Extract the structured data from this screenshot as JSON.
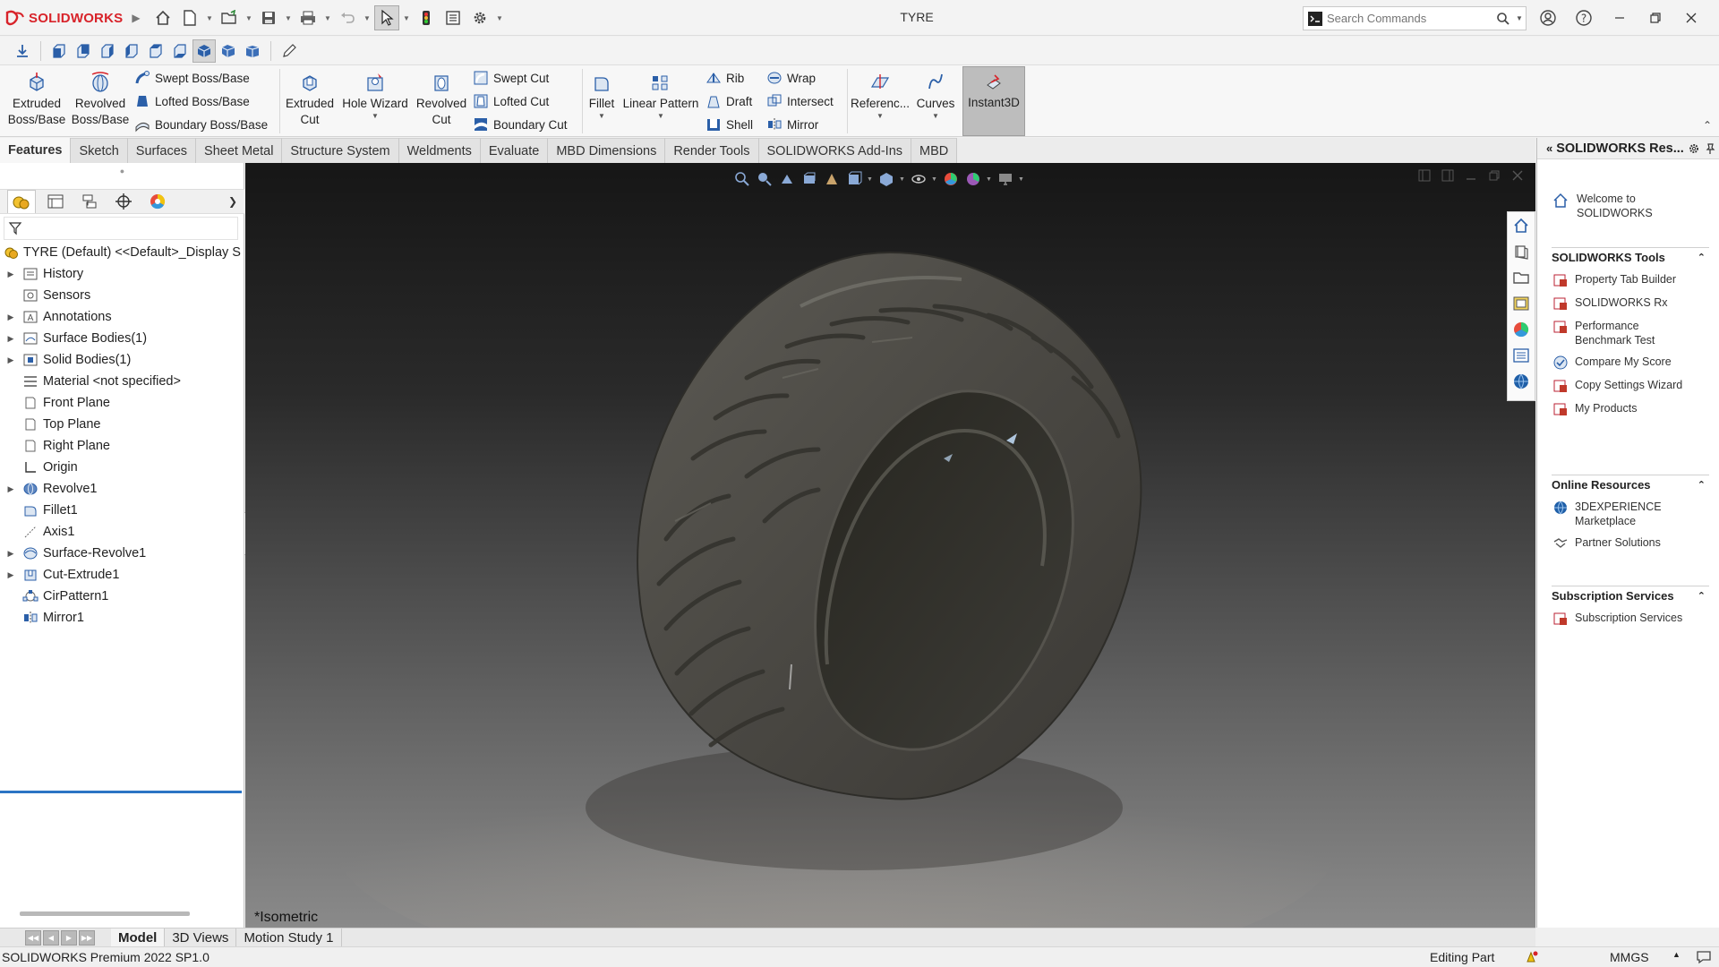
{
  "app": {
    "brand": "SOLIDWORKS",
    "doc_title": "TYRE",
    "search_placeholder": "Search Commands"
  },
  "ribbon": {
    "extruded_boss": [
      "Extruded",
      "Boss/Base"
    ],
    "revolved_boss": [
      "Revolved",
      "Boss/Base"
    ],
    "swept_boss": "Swept Boss/Base",
    "lofted_boss": "Lofted Boss/Base",
    "boundary_boss": "Boundary Boss/Base",
    "extruded_cut": [
      "Extruded",
      "Cut"
    ],
    "hole_wizard": "Hole Wizard",
    "revolved_cut": [
      "Revolved",
      "Cut"
    ],
    "swept_cut": "Swept Cut",
    "lofted_cut": "Lofted Cut",
    "boundary_cut": "Boundary Cut",
    "fillet": "Fillet",
    "linear_pattern": "Linear Pattern",
    "rib": "Rib",
    "draft": "Draft",
    "shell": "Shell",
    "wrap": "Wrap",
    "intersect": "Intersect",
    "mirror": "Mirror",
    "reference": "Referenc...",
    "curves": "Curves",
    "instant3d": "Instant3D"
  },
  "tabs": [
    "Features",
    "Sketch",
    "Surfaces",
    "Sheet Metal",
    "Structure System",
    "Weldments",
    "Evaluate",
    "MBD Dimensions",
    "Render Tools",
    "SOLIDWORKS Add-Ins",
    "MBD"
  ],
  "tree": {
    "root": "TYRE (Default) <<Default>_Display S",
    "items": [
      {
        "label": "History",
        "expandable": true,
        "icon": "history-icon"
      },
      {
        "label": "Sensors",
        "expandable": false,
        "icon": "sensor-icon"
      },
      {
        "label": "Annotations",
        "expandable": true,
        "icon": "annotation-icon"
      },
      {
        "label": "Surface Bodies(1)",
        "expandable": true,
        "icon": "surface-bodies-icon"
      },
      {
        "label": "Solid Bodies(1)",
        "expandable": true,
        "icon": "solid-bodies-icon"
      },
      {
        "label": "Material <not specified>",
        "expandable": false,
        "icon": "material-icon"
      },
      {
        "label": "Front Plane",
        "expandable": false,
        "icon": "plane-icon"
      },
      {
        "label": "Top Plane",
        "expandable": false,
        "icon": "plane-icon"
      },
      {
        "label": "Right Plane",
        "expandable": false,
        "icon": "plane-icon"
      },
      {
        "label": "Origin",
        "expandable": false,
        "icon": "origin-icon"
      },
      {
        "label": "Revolve1",
        "expandable": true,
        "icon": "revolve-icon"
      },
      {
        "label": "Fillet1",
        "expandable": false,
        "icon": "fillet-icon"
      },
      {
        "label": "Axis1",
        "expandable": false,
        "icon": "axis-icon"
      },
      {
        "label": "Surface-Revolve1",
        "expandable": true,
        "icon": "surface-revolve-icon"
      },
      {
        "label": "Cut-Extrude1",
        "expandable": true,
        "icon": "cut-extrude-icon"
      },
      {
        "label": "CirPattern1",
        "expandable": false,
        "icon": "circular-pattern-icon"
      },
      {
        "label": "Mirror1",
        "expandable": false,
        "icon": "mirror-icon"
      }
    ]
  },
  "viewport": {
    "view_label": "*Isometric"
  },
  "taskpane": {
    "title": "SOLIDWORKS Res...",
    "welcome": [
      "Welcome to",
      "SOLIDWORKS"
    ],
    "tools_title": "SOLIDWORKS Tools",
    "tools": [
      [
        "Property Tab Builder"
      ],
      [
        "SOLIDWORKS Rx"
      ],
      [
        "Performance",
        "Benchmark Test"
      ],
      [
        "Compare My Score"
      ],
      [
        "Copy Settings Wizard"
      ],
      [
        "My Products"
      ]
    ],
    "online_title": "Online Resources",
    "online": [
      [
        "3DEXPERIENCE",
        "Marketplace"
      ],
      [
        "Partner Solutions"
      ]
    ],
    "subscription_title": "Subscription Services",
    "subscription": [
      [
        "Subscription Services"
      ]
    ]
  },
  "bottom_tabs": [
    "Model",
    "3D Views",
    "Motion Study 1"
  ],
  "status": {
    "product": "SOLIDWORKS Premium 2022 SP1.0",
    "mode": "Editing Part",
    "units": "MMGS"
  },
  "colors": {
    "brand_red": "#d8232a",
    "selection_blue": "#2b74c4",
    "tyre": "#4a4843"
  }
}
